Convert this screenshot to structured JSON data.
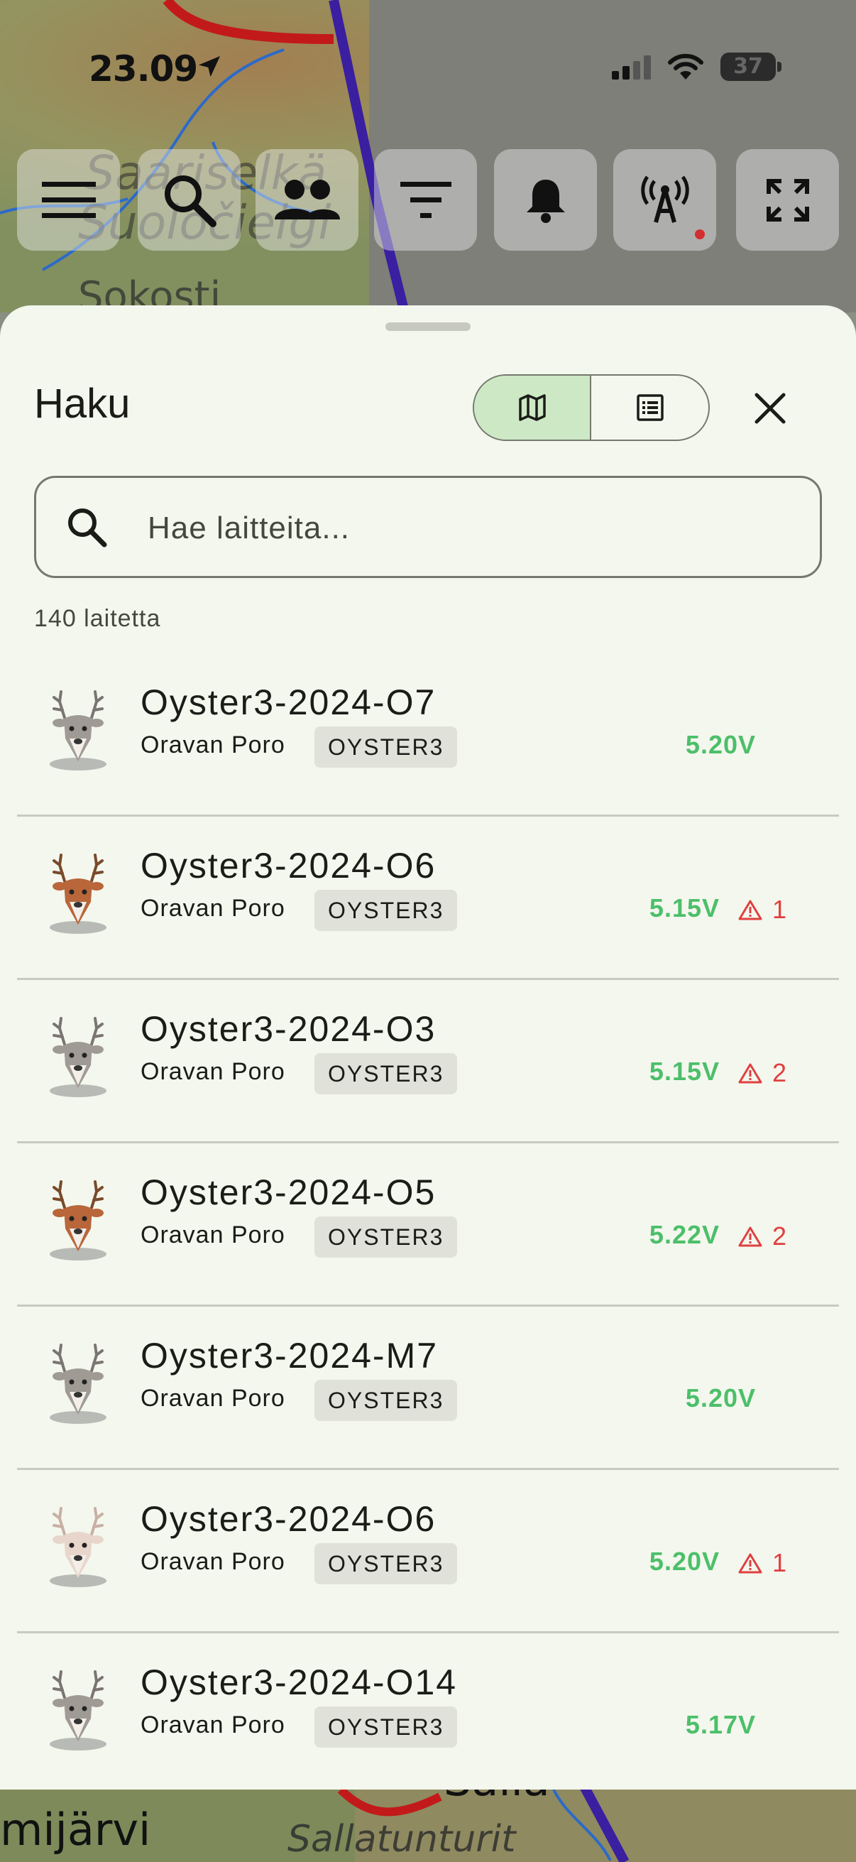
{
  "status_bar": {
    "time": "23.09",
    "battery": "37"
  },
  "map": {
    "labels": {
      "top1": "Saariselkä",
      "top2": "Suoločielgi",
      "top3": "Sokosti",
      "bottom1": "mijärvi",
      "bottom2": "Sallatunturit",
      "bottom3": "Salla"
    }
  },
  "toolbar": {
    "buttons": [
      "menu-icon",
      "search-icon",
      "people-icon",
      "filter-icon",
      "bell-icon",
      "antenna-icon",
      "fullscreen-icon"
    ]
  },
  "sheet": {
    "title": "Haku",
    "view_toggle": {
      "options": [
        "map-icon",
        "list-icon"
      ],
      "selected": "map"
    },
    "search": {
      "placeholder": "Hae laitteita...",
      "value": ""
    },
    "count_label": "140 laitetta"
  },
  "devices": [
    {
      "name": "Oyster3-2024-O7",
      "owner": "Oravan Poro",
      "type": "OYSTER3",
      "voltage": "5.20V",
      "alerts": null,
      "color": "gray"
    },
    {
      "name": "Oyster3-2024-O6",
      "owner": "Oravan Poro",
      "type": "OYSTER3",
      "voltage": "5.15V",
      "alerts": "1",
      "color": "brown"
    },
    {
      "name": "Oyster3-2024-O3",
      "owner": "Oravan Poro",
      "type": "OYSTER3",
      "voltage": "5.15V",
      "alerts": "2",
      "color": "gray"
    },
    {
      "name": "Oyster3-2024-O5",
      "owner": "Oravan Poro",
      "type": "OYSTER3",
      "voltage": "5.22V",
      "alerts": "2",
      "color": "brown"
    },
    {
      "name": "Oyster3-2024-M7",
      "owner": "Oravan Poro",
      "type": "OYSTER3",
      "voltage": "5.20V",
      "alerts": null,
      "color": "gray"
    },
    {
      "name": "Oyster3-2024-O6",
      "owner": "Oravan Poro",
      "type": "OYSTER3",
      "voltage": "5.20V",
      "alerts": "1",
      "color": "white"
    },
    {
      "name": "Oyster3-2024-O14",
      "owner": "Oravan Poro",
      "type": "OYSTER3",
      "voltage": "5.17V",
      "alerts": null,
      "color": "gray"
    }
  ],
  "colors": {
    "sheet_bg": "#f4f7ee",
    "voltage_green": "#4cbf6a",
    "alert_red": "#e04040",
    "toggle_selected": "#cde8c5"
  }
}
